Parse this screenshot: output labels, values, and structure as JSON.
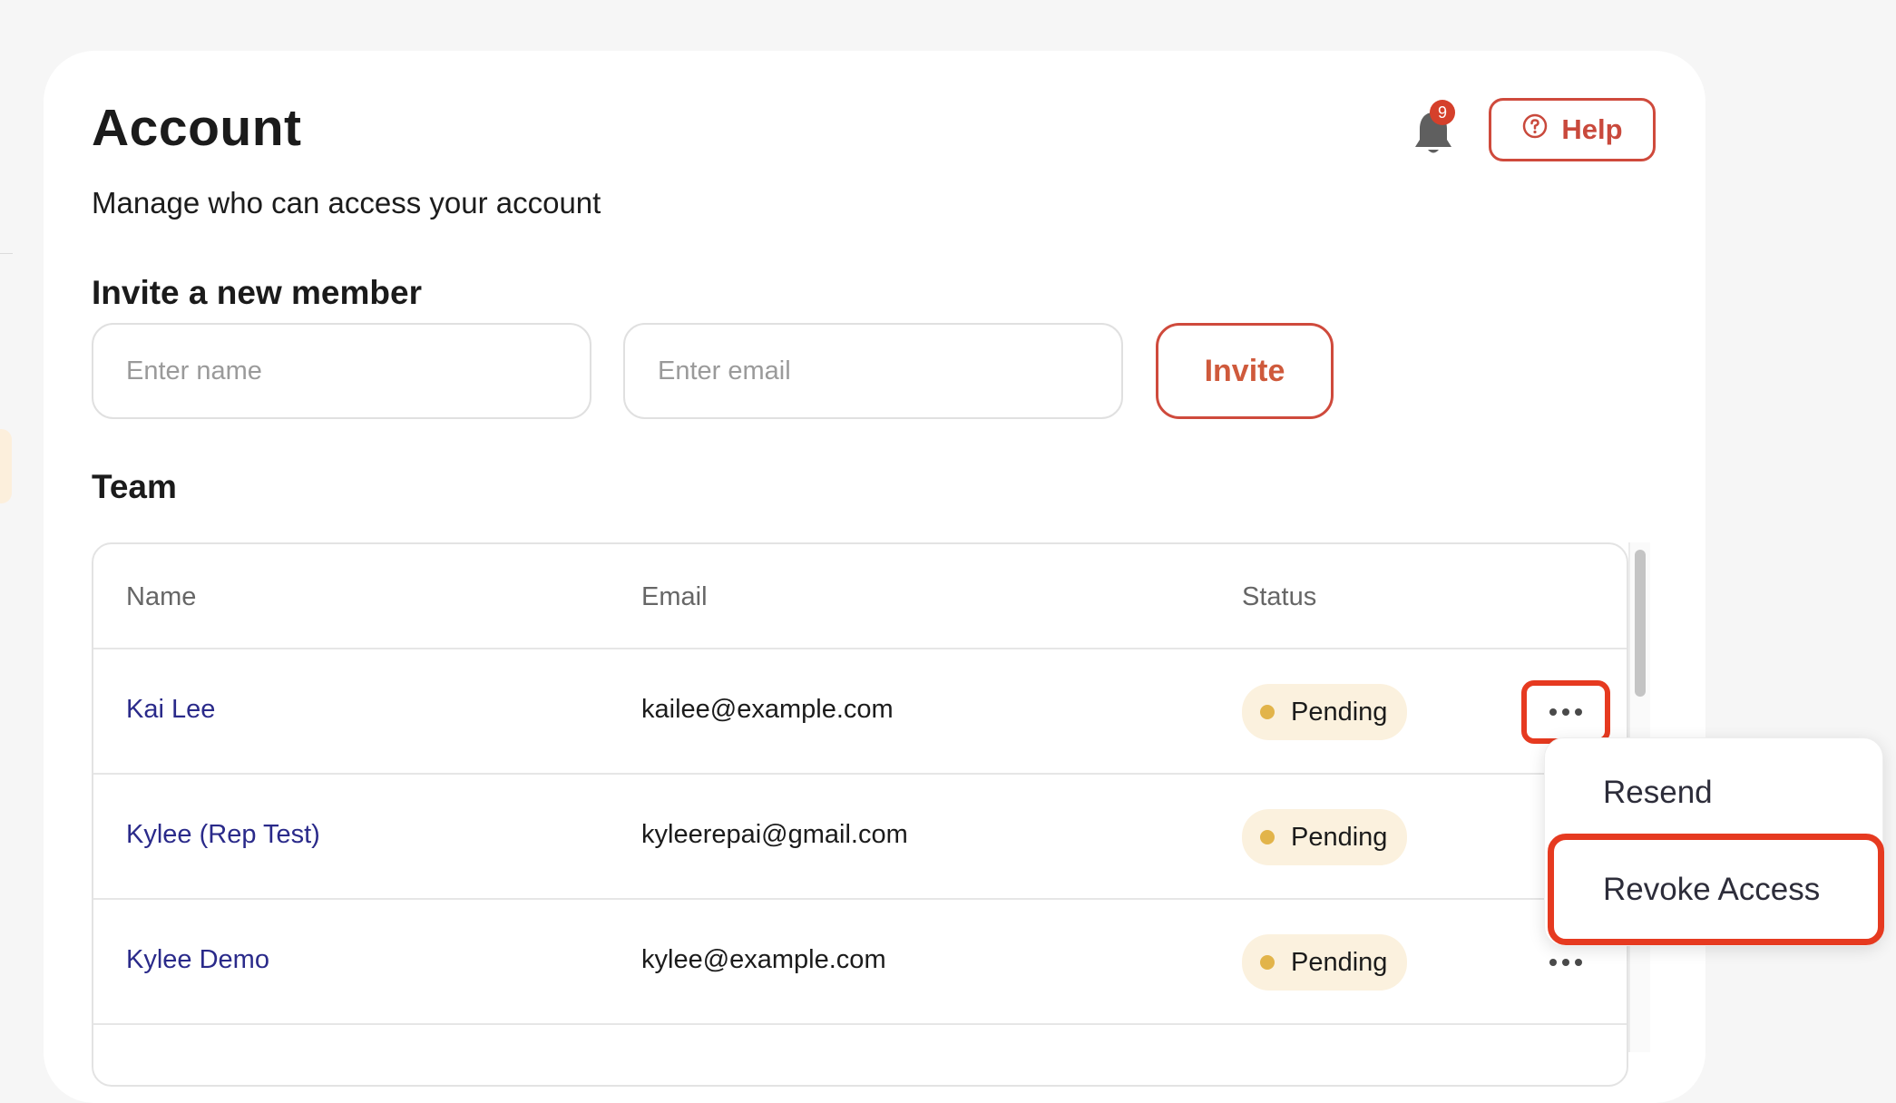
{
  "header": {
    "title": "Account",
    "subtitle": "Manage who can access your account",
    "notification_count": "9",
    "help_label": "Help"
  },
  "invite": {
    "section_title": "Invite a new member",
    "name_placeholder": "Enter name",
    "email_placeholder": "Enter email",
    "invite_label": "Invite"
  },
  "team": {
    "section_title": "Team",
    "columns": [
      "Name",
      "Email",
      "Status"
    ],
    "rows": [
      {
        "name": "Kai Lee",
        "email": "kailee@example.com",
        "status": "Pending"
      },
      {
        "name": "Kylee (Rep Test)",
        "email": "kyleerepai@gmail.com",
        "status": "Pending"
      },
      {
        "name": "Kylee Demo",
        "email": "kylee@example.com",
        "status": "Pending"
      }
    ]
  },
  "row_menu": {
    "items": [
      "Resend",
      "Revoke Access"
    ]
  },
  "colors": {
    "accent": "#cf4a3c",
    "highlight": "#e63a20",
    "link": "#2a2a8a",
    "status_pending_bg": "#fbf1de",
    "status_pending_dot": "#e2b44a"
  },
  "icons": {
    "notification": "bell-icon",
    "help": "question-circle-icon",
    "row_actions": "more-horizontal-icon"
  }
}
